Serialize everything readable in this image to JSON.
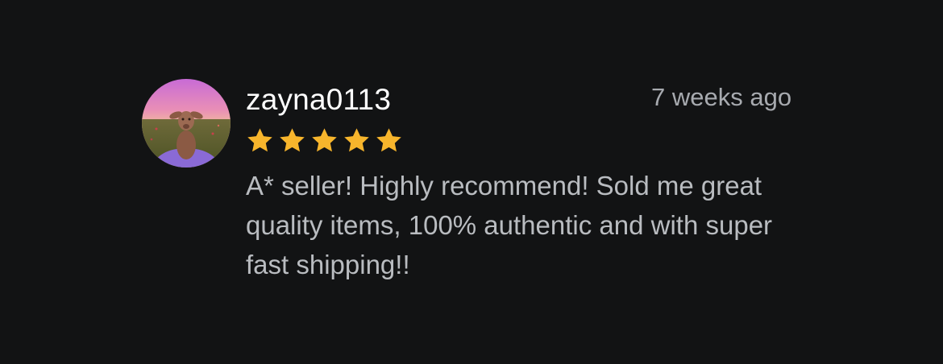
{
  "review": {
    "username": "zayna0113",
    "timestamp": "7 weeks ago",
    "rating": 5,
    "rating_max": 5,
    "text": "A* seller! Highly recommend! Sold me great quality items, 100% authentic and with super fast shipping!!"
  },
  "avatar": {
    "icon": "avatar-lamb-photo"
  },
  "colors": {
    "background": "#121314",
    "username": "#ffffff",
    "timestamp": "#a7aaaf",
    "text": "#b9bcc0",
    "star": "#f7b52c"
  }
}
